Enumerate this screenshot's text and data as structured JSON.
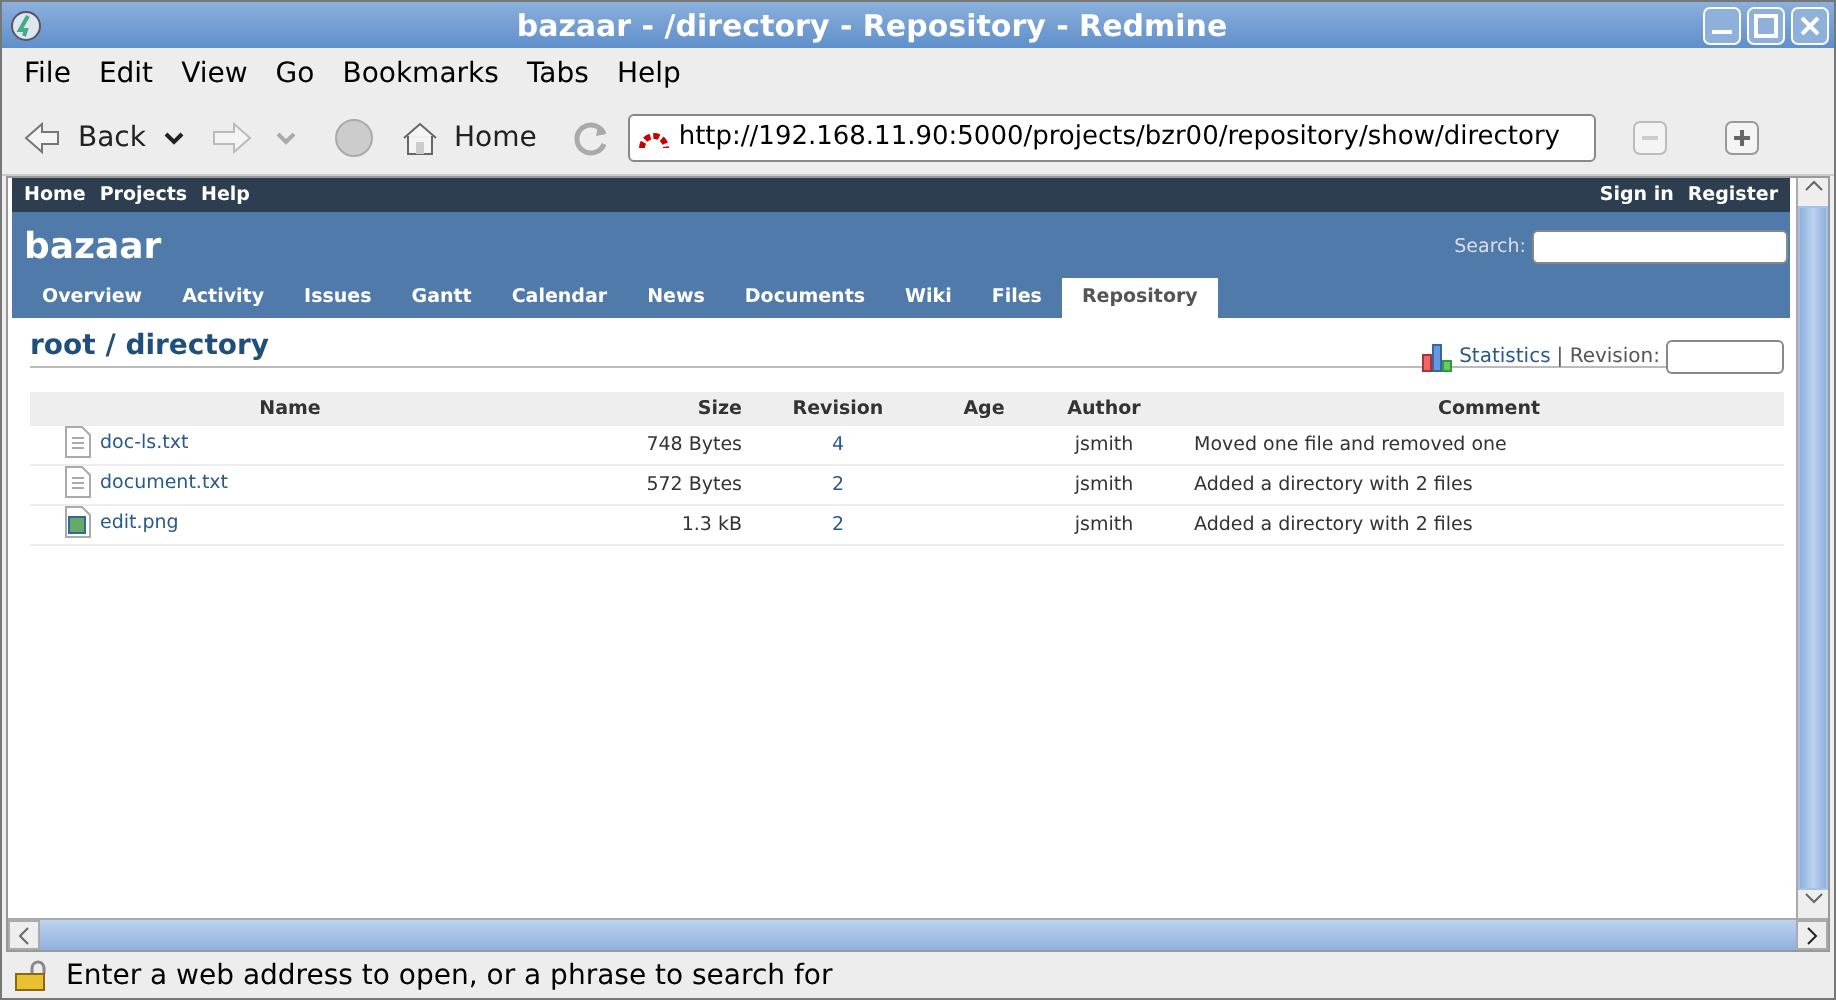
{
  "window": {
    "title": "bazaar - /directory - Repository - Redmine"
  },
  "menu": [
    "File",
    "Edit",
    "View",
    "Go",
    "Bookmarks",
    "Tabs",
    "Help"
  ],
  "toolbar": {
    "back": "Back",
    "home": "Home",
    "address": "http://192.168.11.90:5000/projects/bzr00/repository/show/directory"
  },
  "top_menu": {
    "left": [
      "Home",
      "Projects",
      "Help"
    ],
    "right": [
      "Sign in",
      "Register"
    ]
  },
  "project": {
    "name": "bazaar",
    "search_label": "Search:"
  },
  "tabs": [
    {
      "label": "Overview",
      "selected": false
    },
    {
      "label": "Activity",
      "selected": false
    },
    {
      "label": "Issues",
      "selected": false
    },
    {
      "label": "Gantt",
      "selected": false
    },
    {
      "label": "Calendar",
      "selected": false
    },
    {
      "label": "News",
      "selected": false
    },
    {
      "label": "Documents",
      "selected": false
    },
    {
      "label": "Wiki",
      "selected": false
    },
    {
      "label": "Files",
      "selected": false
    },
    {
      "label": "Repository",
      "selected": true
    }
  ],
  "heading": "root / directory",
  "statistics_link": "Statistics",
  "revision_label": "| Revision:",
  "table": {
    "columns": [
      "Name",
      "Size",
      "Revision",
      "Age",
      "Author",
      "Comment"
    ],
    "rows": [
      {
        "kind": "text",
        "name": "doc-ls.txt",
        "size": "748 Bytes",
        "revision": "4",
        "author": "jsmith",
        "comment": "Moved one file and removed one"
      },
      {
        "kind": "text",
        "name": "document.txt",
        "size": "572 Bytes",
        "revision": "2",
        "author": "jsmith",
        "comment": "Added a directory with 2 files"
      },
      {
        "kind": "image",
        "name": "edit.png",
        "size": "1.3 kB",
        "revision": "2",
        "author": "jsmith",
        "comment": "Added a directory with 2 files"
      }
    ]
  },
  "status_bar": "Enter a web address to open, or a phrase to search for"
}
